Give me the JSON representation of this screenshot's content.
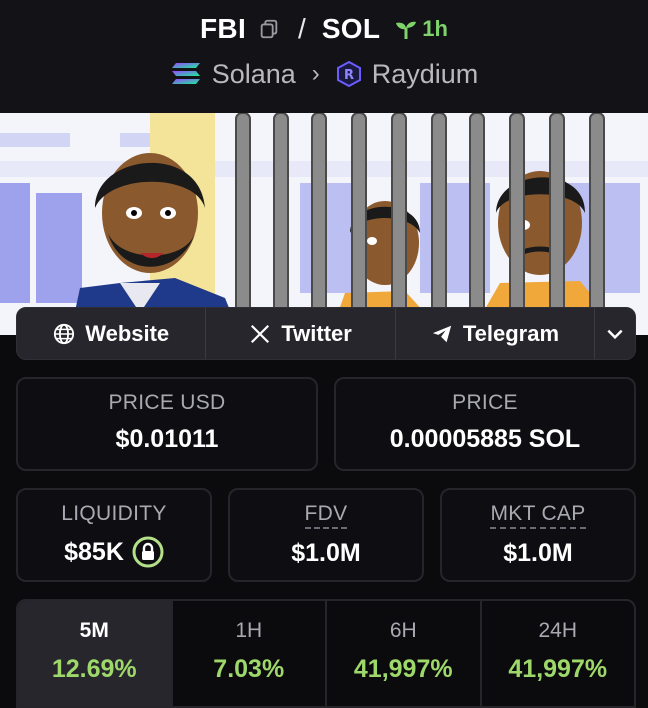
{
  "pair": {
    "base": "FBI",
    "separator": "/",
    "quote": "SOL",
    "age": "1h"
  },
  "chain": {
    "name": "Solana",
    "dex": "Raydium"
  },
  "links": {
    "website": "Website",
    "twitter": "Twitter",
    "telegram": "Telegram"
  },
  "stats": {
    "price_usd_label": "PRICE USD",
    "price_usd": "$0.01011",
    "price_label": "PRICE",
    "price": "0.00005885 SOL",
    "liquidity_label": "LIQUIDITY",
    "liquidity": "$85K",
    "fdv_label": "FDV",
    "fdv": "$1.0M",
    "mktcap_label": "MKT CAP",
    "mktcap": "$1.0M"
  },
  "timeframes": [
    {
      "label": "5M",
      "change": "12.69%"
    },
    {
      "label": "1H",
      "change": "7.03%"
    },
    {
      "label": "6H",
      "change": "41,997%"
    },
    {
      "label": "24H",
      "change": "41,997%"
    }
  ],
  "colors": {
    "accent_green": "#9fd86a",
    "age_green": "#7ed36a",
    "background": "#0b0b0e"
  }
}
